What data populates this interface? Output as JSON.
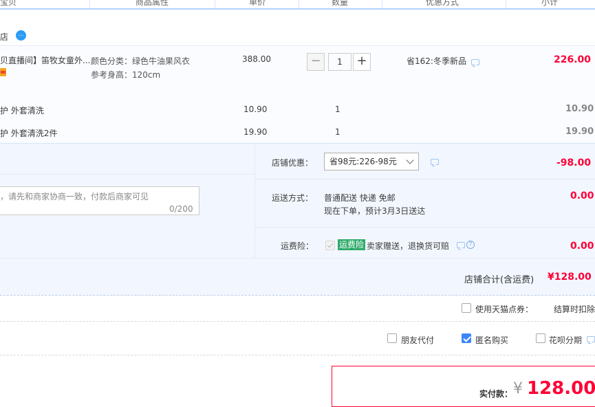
{
  "header": {
    "cols": [
      "宝贝",
      "商品属性",
      "单价",
      "数量",
      "优惠方式",
      "小计"
    ]
  },
  "shop": {
    "name_fragment": "店",
    "icon": "chat-bubble-icon"
  },
  "item": {
    "title": "贝直播间】笛牧女童外...",
    "attr_color": "颜色分类：绿色牛油果风衣",
    "attr_height": "参考身高：120cm",
    "price": "388.00",
    "qty_minus": "−",
    "qty_value": "1",
    "qty_plus": "+",
    "promo": "省162:冬季新品",
    "subtotal": "226.00"
  },
  "services": [
    {
      "name": "护 外套清洗",
      "price": "10.90",
      "qty": "1",
      "subtotal": "10.90"
    },
    {
      "name": "护 外套清洗2件",
      "price": "19.90",
      "qty": "1",
      "subtotal": "19.90"
    }
  ],
  "order": {
    "discount_label": "店铺优惠：",
    "discount_select": "省98元:226-98元",
    "discount_amount": "-98.00",
    "message_placeholder": "，请先和商家协商一致，付款后商家可见",
    "message_counter": "0/200",
    "shipping_label": "运送方式：",
    "shipping_method": "普通配送 快递 免邮",
    "shipping_eta": "现在下单，预计3月3日送达",
    "shipping_amount": "0.00",
    "insurance_label": "运费险：",
    "insurance_tag": "运费险",
    "insurance_text": "卖家赠送，退换货可赔",
    "insurance_amount": "0.00",
    "shop_total_label": "店铺合计(含运费)",
    "shop_total": "¥128.00"
  },
  "options": {
    "tmall_coupon": "使用天猫点券：",
    "settle_deduct": "结算时扣除",
    "friend_pay": "朋友代付",
    "anonymous": "匿名购买",
    "huabei": "花呗分期"
  },
  "payment": {
    "label": "实付款：",
    "currency": "¥",
    "amount": "128.00"
  },
  "colors": {
    "accent": "#ff0036",
    "blue": "#3a86ff",
    "green": "#2fab6a"
  }
}
